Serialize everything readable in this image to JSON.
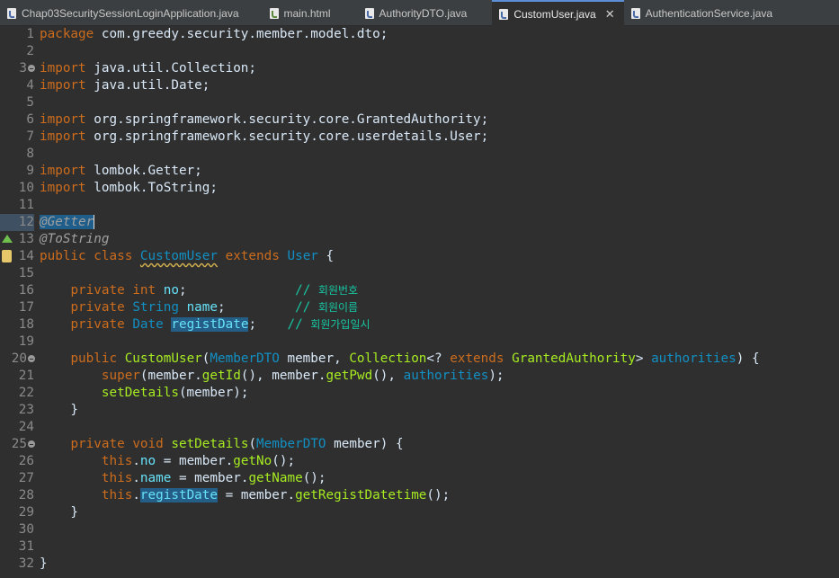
{
  "tabs": [
    {
      "label": "Chap03SecuritySessionLoginApplication.java",
      "icon": "java-file-icon",
      "active": false
    },
    {
      "label": "main.html",
      "icon": "html-file-icon",
      "active": false
    },
    {
      "label": "AuthorityDTO.java",
      "icon": "java-file-icon",
      "active": false
    },
    {
      "label": "CustomUser.java",
      "icon": "java-file-icon",
      "active": true
    },
    {
      "label": "AuthenticationService.java",
      "icon": "java-file-icon",
      "active": false
    }
  ],
  "close_glyph": "✕",
  "lines": {
    "n": [
      "1",
      "2",
      "3",
      "4",
      "5",
      "6",
      "7",
      "8",
      "9",
      "10",
      "11",
      "12",
      "13",
      "14",
      "15",
      "16",
      "17",
      "18",
      "19",
      "20",
      "21",
      "22",
      "23",
      "24",
      "25",
      "26",
      "27",
      "28",
      "29",
      "30",
      "31",
      "32"
    ]
  },
  "code": {
    "l1": [
      "package",
      " com.greedy.security.member.model.dto;"
    ],
    "l3": [
      "import",
      " java.util.Collection;"
    ],
    "l4": [
      "import",
      " java.util.Date;"
    ],
    "l6": [
      "import",
      " org.springframework.security.core.GrantedAuthority;"
    ],
    "l7": [
      "import",
      " org.springframework.security.core.userdetails.User;"
    ],
    "l9": [
      "import",
      " lombok.Getter;"
    ],
    "l10": [
      "import",
      " lombok.ToString;"
    ],
    "l12": [
      "@Getter"
    ],
    "l13": [
      "@ToString"
    ],
    "l14": [
      "public",
      " ",
      "class",
      " ",
      "CustomUser",
      " ",
      "extends",
      " ",
      "User",
      " {"
    ],
    "l16": [
      "    ",
      "private",
      " ",
      "int",
      " ",
      "no",
      ";              ",
      "// ",
      "회원번호"
    ],
    "l17": [
      "    ",
      "private",
      " ",
      "String",
      " ",
      "name",
      ";         ",
      "// ",
      "회원이름"
    ],
    "l18": [
      "    ",
      "private",
      " ",
      "Date",
      " ",
      "registDate",
      ";    ",
      "// ",
      "회원가입일시"
    ],
    "l20": [
      "    ",
      "public",
      " ",
      "CustomUser",
      "(",
      "MemberDTO",
      " member, ",
      "Collection",
      "<? ",
      "extends",
      " ",
      "GrantedAuthority",
      "> ",
      "authorities",
      ") {"
    ],
    "l21": [
      "        ",
      "super",
      "(member.",
      "getId",
      "(), member.",
      "getPwd",
      "(), ",
      "authorities",
      ");"
    ],
    "l22": [
      "        ",
      "setDetails",
      "(member);"
    ],
    "l23": [
      "    }"
    ],
    "l25": [
      "    ",
      "private",
      " ",
      "void",
      " ",
      "setDetails",
      "(",
      "MemberDTO",
      " member) {"
    ],
    "l26": [
      "        ",
      "this",
      ".",
      "no",
      " = member.",
      "getNo",
      "();"
    ],
    "l27": [
      "        ",
      "this",
      ".",
      "name",
      " = member.",
      "getName",
      "();"
    ],
    "l28": [
      "        ",
      "this",
      ".",
      "registDate",
      " = member.",
      "getRegistDatetime",
      "();"
    ],
    "l29": [
      "    }"
    ],
    "l32": [
      "}"
    ]
  },
  "colors": {
    "keyword": "#cc6c1d",
    "type": "#1290c3",
    "comment": "#17c6a3",
    "method": "#a7ec21",
    "field": "#66e1f8",
    "text": "#d9e8f7",
    "background": "#2f2f2f"
  }
}
